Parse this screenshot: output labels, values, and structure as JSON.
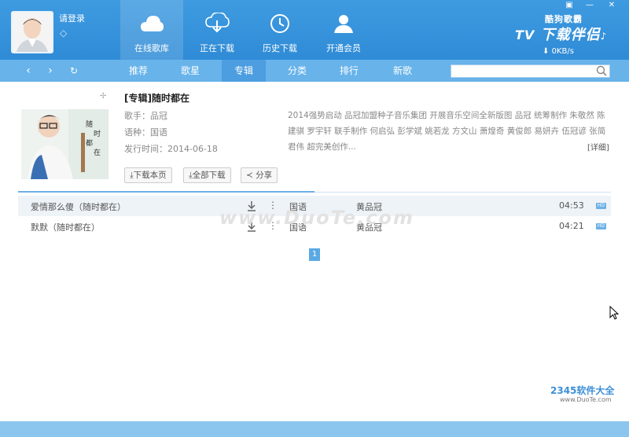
{
  "header": {
    "login_text": "请登录",
    "nav": [
      {
        "label": "在线歌库"
      },
      {
        "label": "正在下载"
      },
      {
        "label": "历史下载"
      },
      {
        "label": "开通会员"
      }
    ],
    "logo_small": "酷狗歌霸",
    "logo_big": "下载伴侣",
    "speed": "0KB/s"
  },
  "tabs": [
    {
      "label": "推荐"
    },
    {
      "label": "歌星"
    },
    {
      "label": "专辑"
    },
    {
      "label": "分类"
    },
    {
      "label": "排行"
    },
    {
      "label": "新歌"
    }
  ],
  "search": {
    "placeholder": ""
  },
  "album": {
    "title": "[专辑]随时都在",
    "singer": "歌手：品冠",
    "language": "语种：国语",
    "release": "发行时间：2014-06-18",
    "description": "2014强势启动 品冠加盟种子音乐集团 开展音乐空间全新版图 品冠 统筹制作 朱敬然 陈建骐 罗宇轩 联手制作 何启弘 彭学斌 姚若龙 方文山 萧煌奇 黄俊郎 易妍卉 伍冠谚 张简君伟 超完美创作...",
    "detail_link": "[详细]",
    "btn_download_page": "下载本页",
    "btn_download_all": "全部下载",
    "btn_share": "分享"
  },
  "songs": [
    {
      "name": "爱情那么傻（随时都在）",
      "language": "国语",
      "artist": "黄品冠",
      "duration": "04:53",
      "quality": "HD"
    },
    {
      "name": "默默（随时都在）",
      "language": "国语",
      "artist": "黄品冠",
      "duration": "04:21",
      "quality": "HD"
    }
  ],
  "pagination": {
    "current": "1"
  },
  "watermark": "www.DuoTe.com",
  "corner_logo": "2345软件大全",
  "corner_sub": "www.DuoTe.com",
  "colors": {
    "header": "#2f8bd6",
    "tabbar": "#67b3ea",
    "accent": "#5aa9e4"
  }
}
